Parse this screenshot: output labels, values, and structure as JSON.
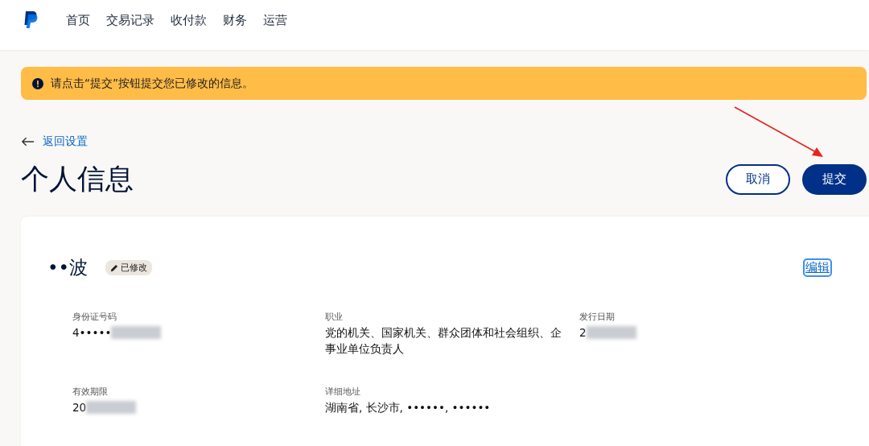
{
  "nav": {
    "items": [
      {
        "label": "首页"
      },
      {
        "label": "交易记录"
      },
      {
        "label": "收付款"
      },
      {
        "label": "财务"
      },
      {
        "label": "运营"
      }
    ]
  },
  "alert": {
    "message": "请点击“提交”按钮提交您已修改的信息。"
  },
  "back_link": "返回设置",
  "page_title": "个人信息",
  "buttons": [
    {
      "label": "取消",
      "kind": "secondary"
    },
    {
      "label": "提交",
      "kind": "primary"
    }
  ],
  "card": {
    "name": "••波",
    "badge": "已修改",
    "edit_link": "编辑",
    "fields": [
      {
        "label": "身份证号码",
        "value": "4•••••",
        "redacted": true
      },
      {
        "label": "职业",
        "value": "党的机关、国家机关、群众团体和社会组织、企事业单位负责人",
        "redacted": false
      },
      {
        "label": "发行日期",
        "value": "2",
        "redacted": true
      },
      {
        "label": "有效期限",
        "value": "20",
        "redacted": true
      },
      {
        "label": "详细地址",
        "value": "湖南省, 长沙市, ••••••, ••••••",
        "redacted": false
      }
    ]
  }
}
